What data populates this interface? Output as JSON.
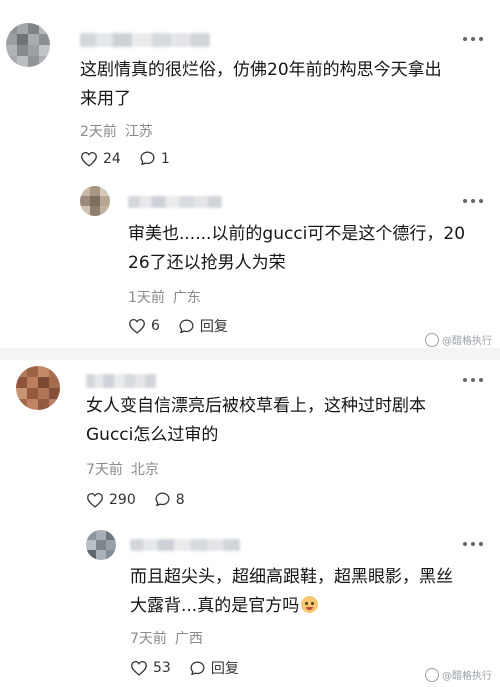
{
  "comments": [
    {
      "text_line1": "这剧情真的很烂俗，仿佛20年前的构思今天拿出",
      "text_line2": "来用了",
      "time": "2天前",
      "location": "江苏",
      "likes": "24",
      "replies": "1",
      "reply": {
        "text_line1": "审美也......以前的gucci可不是这个德行，20",
        "text_line2": "26了还以抢男人为荣",
        "time": "1天前",
        "location": "广东",
        "likes": "6",
        "reply_label": "回复"
      }
    },
    {
      "text_line1": "女人变自信漂亮后被校草看上，这种过时剧本",
      "text_line2": "Gucci怎么过审的",
      "time": "7天前",
      "location": "北京",
      "likes": "290",
      "replies": "8",
      "reply": {
        "text_line1": "而且超尖头，超细高跟鞋，超黑眼影，黑丝",
        "text_line2": "大露背...真的是官方吗",
        "time": "7天前",
        "location": "广西",
        "likes": "53",
        "reply_label": "回复"
      }
    }
  ],
  "watermark": "@醋格执行",
  "icons": {
    "like": "heart-outline-icon",
    "comment": "speech-bubble-icon",
    "more": "more-dots-icon"
  },
  "colors": {
    "text": "#151515",
    "meta": "#8a8a8a",
    "divider": "#f3f4f6"
  }
}
